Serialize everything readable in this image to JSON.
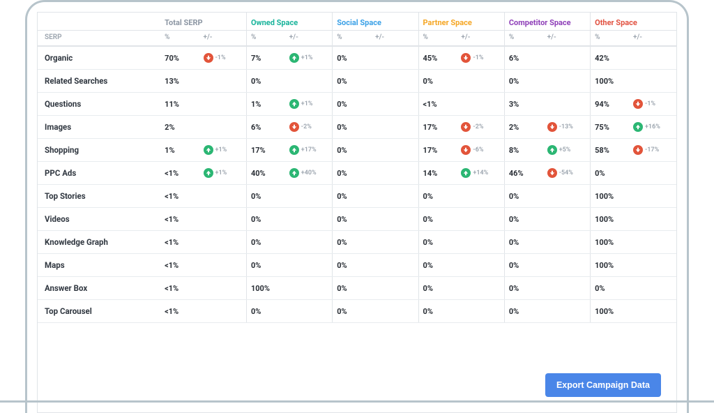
{
  "button": {
    "export": "Export Campaign Data"
  },
  "columns": [
    {
      "key": "total",
      "label": "Total SERP",
      "class": "hdr-total"
    },
    {
      "key": "owned",
      "label": "Owned Space",
      "class": "hdr-owned"
    },
    {
      "key": "social",
      "label": "Social Space",
      "class": "hdr-social"
    },
    {
      "key": "partner",
      "label": "Partner Space",
      "class": "hdr-partner"
    },
    {
      "key": "competitor",
      "label": "Competitor Space",
      "class": "hdr-competitor"
    },
    {
      "key": "other",
      "label": "Other Space",
      "class": "hdr-other"
    }
  ],
  "subheaders": {
    "serp": "SERP",
    "pct": "%",
    "delta": "+/-"
  },
  "rows": [
    {
      "label": "Organic",
      "cells": {
        "total": {
          "pct": "70%",
          "delta": "-1%",
          "dir": "down"
        },
        "owned": {
          "pct": "7%",
          "delta": "+1%",
          "dir": "up"
        },
        "social": {
          "pct": "0%"
        },
        "partner": {
          "pct": "45%",
          "delta": "-1%",
          "dir": "down"
        },
        "competitor": {
          "pct": "6%"
        },
        "other": {
          "pct": "42%"
        }
      }
    },
    {
      "label": "Related Searches",
      "cells": {
        "total": {
          "pct": "13%"
        },
        "owned": {
          "pct": "0%"
        },
        "social": {
          "pct": "0%"
        },
        "partner": {
          "pct": "0%"
        },
        "competitor": {
          "pct": "0%"
        },
        "other": {
          "pct": "100%"
        }
      }
    },
    {
      "label": "Questions",
      "cells": {
        "total": {
          "pct": "11%"
        },
        "owned": {
          "pct": "1%",
          "delta": "+1%",
          "dir": "up"
        },
        "social": {
          "pct": "0%"
        },
        "partner": {
          "pct": "<1%"
        },
        "competitor": {
          "pct": "3%"
        },
        "other": {
          "pct": "94%",
          "delta": "-1%",
          "dir": "down"
        }
      }
    },
    {
      "label": "Images",
      "cells": {
        "total": {
          "pct": "2%"
        },
        "owned": {
          "pct": "6%",
          "delta": "-2%",
          "dir": "down"
        },
        "social": {
          "pct": "0%"
        },
        "partner": {
          "pct": "17%",
          "delta": "-2%",
          "dir": "down"
        },
        "competitor": {
          "pct": "2%",
          "delta": "-13%",
          "dir": "down"
        },
        "other": {
          "pct": "75%",
          "delta": "+16%",
          "dir": "up"
        }
      }
    },
    {
      "label": "Shopping",
      "cells": {
        "total": {
          "pct": "1%",
          "delta": "+1%",
          "dir": "up"
        },
        "owned": {
          "pct": "17%",
          "delta": "+17%",
          "dir": "up"
        },
        "social": {
          "pct": "0%"
        },
        "partner": {
          "pct": "17%",
          "delta": "-6%",
          "dir": "down"
        },
        "competitor": {
          "pct": "8%",
          "delta": "+5%",
          "dir": "up"
        },
        "other": {
          "pct": "58%",
          "delta": "-17%",
          "dir": "down"
        }
      }
    },
    {
      "label": "PPC Ads",
      "cells": {
        "total": {
          "pct": "<1%",
          "delta": "+1%",
          "dir": "up"
        },
        "owned": {
          "pct": "40%",
          "delta": "+40%",
          "dir": "up"
        },
        "social": {
          "pct": "0%"
        },
        "partner": {
          "pct": "14%",
          "delta": "+14%",
          "dir": "up"
        },
        "competitor": {
          "pct": "46%",
          "delta": "-54%",
          "dir": "down"
        },
        "other": {
          "pct": "0%"
        }
      }
    },
    {
      "label": "Top Stories",
      "cells": {
        "total": {
          "pct": "<1%"
        },
        "owned": {
          "pct": "0%"
        },
        "social": {
          "pct": "0%"
        },
        "partner": {
          "pct": "0%"
        },
        "competitor": {
          "pct": "0%"
        },
        "other": {
          "pct": "100%"
        }
      }
    },
    {
      "label": "Videos",
      "cells": {
        "total": {
          "pct": "<1%"
        },
        "owned": {
          "pct": "0%"
        },
        "social": {
          "pct": "0%"
        },
        "partner": {
          "pct": "0%"
        },
        "competitor": {
          "pct": "0%"
        },
        "other": {
          "pct": "100%"
        }
      }
    },
    {
      "label": "Knowledge Graph",
      "cells": {
        "total": {
          "pct": "<1%"
        },
        "owned": {
          "pct": "0%"
        },
        "social": {
          "pct": "0%"
        },
        "partner": {
          "pct": "0%"
        },
        "competitor": {
          "pct": "0%"
        },
        "other": {
          "pct": "100%"
        }
      }
    },
    {
      "label": "Maps",
      "cells": {
        "total": {
          "pct": "<1%"
        },
        "owned": {
          "pct": "0%"
        },
        "social": {
          "pct": "0%"
        },
        "partner": {
          "pct": "0%"
        },
        "competitor": {
          "pct": "0%"
        },
        "other": {
          "pct": "100%"
        }
      }
    },
    {
      "label": "Answer Box",
      "cells": {
        "total": {
          "pct": "<1%"
        },
        "owned": {
          "pct": "100%"
        },
        "social": {
          "pct": "0%"
        },
        "partner": {
          "pct": "0%"
        },
        "competitor": {
          "pct": "0%"
        },
        "other": {
          "pct": "0%"
        }
      }
    },
    {
      "label": "Top Carousel",
      "cells": {
        "total": {
          "pct": "<1%"
        },
        "owned": {
          "pct": "0%"
        },
        "social": {
          "pct": "0%"
        },
        "partner": {
          "pct": "0%"
        },
        "competitor": {
          "pct": "0%"
        },
        "other": {
          "pct": "100%"
        }
      }
    }
  ],
  "chart_data": {
    "type": "table",
    "unit": "percent",
    "columns": [
      "Total SERP",
      "Owned Space",
      "Social Space",
      "Partner Space",
      "Competitor Space",
      "Other Space"
    ],
    "rows": [
      "Organic",
      "Related Searches",
      "Questions",
      "Images",
      "Shopping",
      "PPC Ads",
      "Top Stories",
      "Videos",
      "Knowledge Graph",
      "Maps",
      "Answer Box",
      "Top Carousel"
    ],
    "values": [
      [
        70,
        7,
        0,
        45,
        6,
        42
      ],
      [
        13,
        0,
        0,
        0,
        0,
        100
      ],
      [
        11,
        1,
        0,
        0.5,
        3,
        94
      ],
      [
        2,
        6,
        0,
        17,
        2,
        75
      ],
      [
        1,
        17,
        0,
        17,
        8,
        58
      ],
      [
        0.5,
        40,
        0,
        14,
        46,
        0
      ],
      [
        0.5,
        0,
        0,
        0,
        0,
        100
      ],
      [
        0.5,
        0,
        0,
        0,
        0,
        100
      ],
      [
        0.5,
        0,
        0,
        0,
        0,
        100
      ],
      [
        0.5,
        0,
        0,
        0,
        0,
        100
      ],
      [
        0.5,
        100,
        0,
        0,
        0,
        0
      ],
      [
        0.5,
        0,
        0,
        0,
        0,
        100
      ]
    ],
    "deltas": [
      [
        -1,
        1,
        null,
        -1,
        null,
        null
      ],
      [
        null,
        null,
        null,
        null,
        null,
        null
      ],
      [
        null,
        1,
        null,
        null,
        null,
        -1
      ],
      [
        null,
        -2,
        null,
        -2,
        -13,
        16
      ],
      [
        1,
        17,
        null,
        -6,
        5,
        -17
      ],
      [
        1,
        40,
        null,
        14,
        -54,
        null
      ],
      [
        null,
        null,
        null,
        null,
        null,
        null
      ],
      [
        null,
        null,
        null,
        null,
        null,
        null
      ],
      [
        null,
        null,
        null,
        null,
        null,
        null
      ],
      [
        null,
        null,
        null,
        null,
        null,
        null
      ],
      [
        null,
        null,
        null,
        null,
        null,
        null
      ],
      [
        null,
        null,
        null,
        null,
        null,
        null
      ]
    ]
  }
}
